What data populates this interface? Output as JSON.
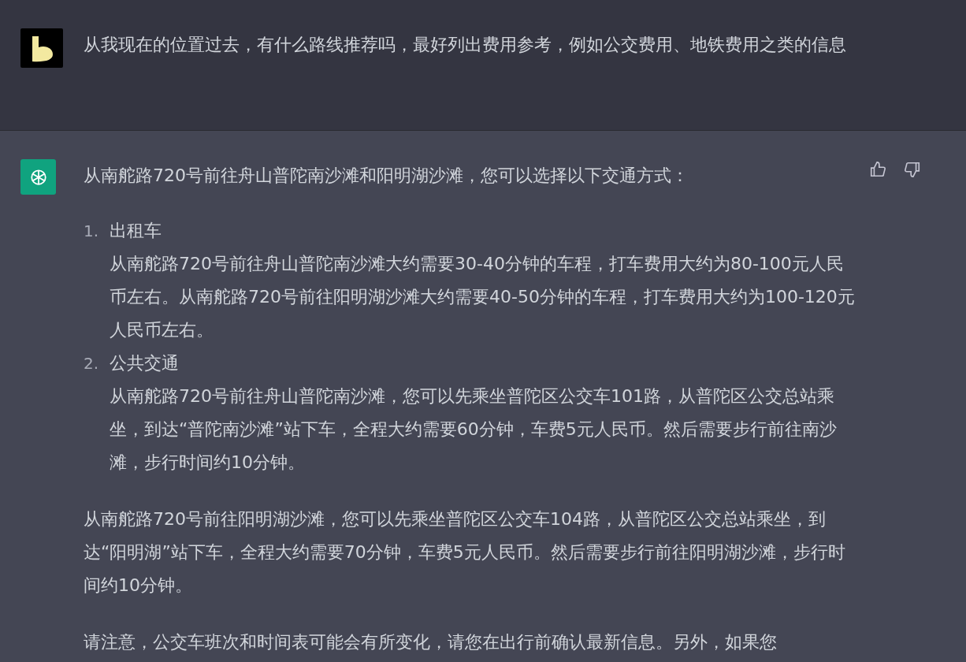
{
  "user_message": {
    "text": "从我现在的位置过去，有什么路线推荐吗，最好列出费用参考，例如公交费用、地铁费用之类的信息"
  },
  "assistant_message": {
    "intro": "从南舵路720号前往舟山普陀南沙滩和阳明湖沙滩，您可以选择以下交通方式：",
    "list": [
      {
        "number": "1.",
        "title": "出租车",
        "text": "从南舵路720号前往舟山普陀南沙滩大约需要30-40分钟的车程，打车费用大约为80-100元人民币左右。从南舵路720号前往阳明湖沙滩大约需要40-50分钟的车程，打车费用大约为100-120元人民币左右。"
      },
      {
        "number": "2.",
        "title": "公共交通",
        "text": "从南舵路720号前往舟山普陀南沙滩，您可以先乘坐普陀区公交车101路，从普陀区公交总站乘坐，到达“普陀南沙滩”站下车，全程大约需要60分钟，车费5元人民币。然后需要步行前往南沙滩，步行时间约10分钟。"
      }
    ],
    "paragraphs": [
      "从南舵路720号前往阳明湖沙滩，您可以先乘坐普陀区公交车104路，从普陀区公交总站乘坐，到达“阳明湖”站下车，全程大约需要70分钟，车费5元人民币。然后需要步行前往阳明湖沙滩，步行时间约10分钟。",
      "请注意，公交车班次和时间表可能会有所变化，请您在出行前确认最新信息。另外，如果您"
    ]
  }
}
